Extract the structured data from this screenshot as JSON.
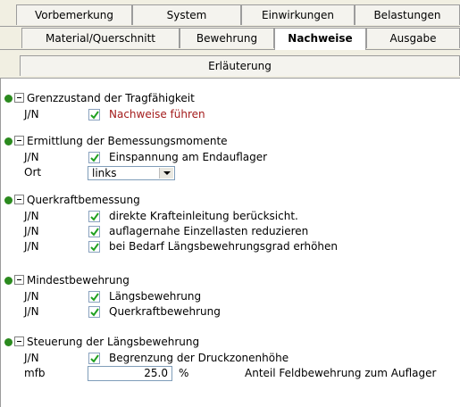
{
  "tabs": {
    "row1": [
      "Vorbemerkung",
      "System",
      "Einwirkungen",
      "Belastungen"
    ],
    "row2": [
      "Material/Querschnitt",
      "Bewehrung",
      "Nachweise",
      "Ausgabe"
    ],
    "row3": [
      "Erläuterung"
    ],
    "active": "Nachweise"
  },
  "sections": {
    "s1": {
      "title": "Grenzzustand der Tragfähigkeit",
      "rows": [
        {
          "label": "J/N",
          "text": "Nachweise führen",
          "checked": true
        }
      ]
    },
    "s2": {
      "title": "Ermittlung der Bemessungsmomente",
      "rows": [
        {
          "label": "J/N",
          "text": "Einspannung am Endauflager",
          "checked": true
        }
      ],
      "select": {
        "label": "Ort",
        "value": "links"
      }
    },
    "s3": {
      "title": "Querkraftbemessung",
      "rows": [
        {
          "label": "J/N",
          "text": "direkte Krafteinleitung berücksicht.",
          "checked": true
        },
        {
          "label": "J/N",
          "text": "auflagernahe Einzellasten reduzieren",
          "checked": true
        },
        {
          "label": "J/N",
          "text": "bei Bedarf Längsbewehrungsgrad erhöhen",
          "checked": true
        }
      ]
    },
    "s4": {
      "title": "Mindestbewehrung",
      "rows": [
        {
          "label": "J/N",
          "text": "Längsbewehrung",
          "checked": true
        },
        {
          "label": "J/N",
          "text": "Querkraftbewehrung",
          "checked": true
        }
      ]
    },
    "s5": {
      "title": "Steuerung der Längsbewehrung",
      "rows": [
        {
          "label": "J/N",
          "text": "Begrenzung der Druckzonenhöhe",
          "checked": true
        }
      ],
      "input": {
        "label": "mfb",
        "value": "25.0",
        "unit": "%",
        "note": "Anteil Feldbewehrung zum Auflager"
      }
    }
  },
  "colors": {
    "status_dot": "#2b8a1e",
    "red_text": "#a41c1c"
  }
}
